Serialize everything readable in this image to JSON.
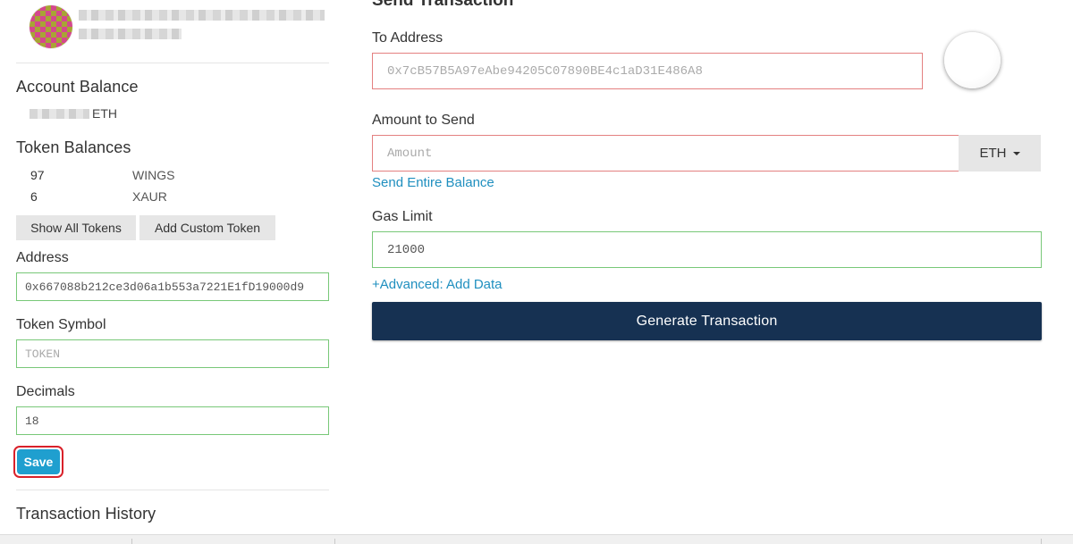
{
  "sidebar": {
    "account_balance_title": "Account Balance",
    "eth_unit": "ETH",
    "token_balances_title": "Token Balances",
    "tokens": [
      {
        "amount": "97",
        "symbol": "WINGS"
      },
      {
        "amount": "6",
        "symbol": "XAUR"
      }
    ],
    "show_all_tokens_label": "Show All Tokens",
    "add_custom_token_label": "Add Custom Token",
    "custom_token": {
      "address_label": "Address",
      "address_value": "0x667088b212ce3d06a1b553a7221E1fD19000d9",
      "symbol_label": "Token Symbol",
      "symbol_placeholder": "TOKEN",
      "decimals_label": "Decimals",
      "decimals_value": "18",
      "save_label": "Save"
    },
    "transaction_history_title": "Transaction History"
  },
  "main": {
    "heading": "Send Transaction",
    "to_address_label": "To Address",
    "to_address_placeholder": "0x7cB57B5A97eAbe94205C07890BE4c1aD31E486A8",
    "amount_label": "Amount to Send",
    "amount_placeholder": "Amount",
    "currency_selected": "ETH",
    "send_entire_balance_label": "Send Entire Balance",
    "gas_limit_label": "Gas Limit",
    "gas_limit_value": "21000",
    "advanced_label": "+Advanced: Add Data",
    "generate_label": "Generate Transaction"
  },
  "colors": {
    "primary_dark": "#163152",
    "link": "#1f8fbf",
    "save_button": "#1f9fcf",
    "highlight_ring": "#d9212a",
    "valid_border": "#78c878",
    "invalid_border": "#e48080"
  },
  "icons": [
    "identicon-avatar",
    "address-identicon-circle",
    "caret-down-icon"
  ]
}
